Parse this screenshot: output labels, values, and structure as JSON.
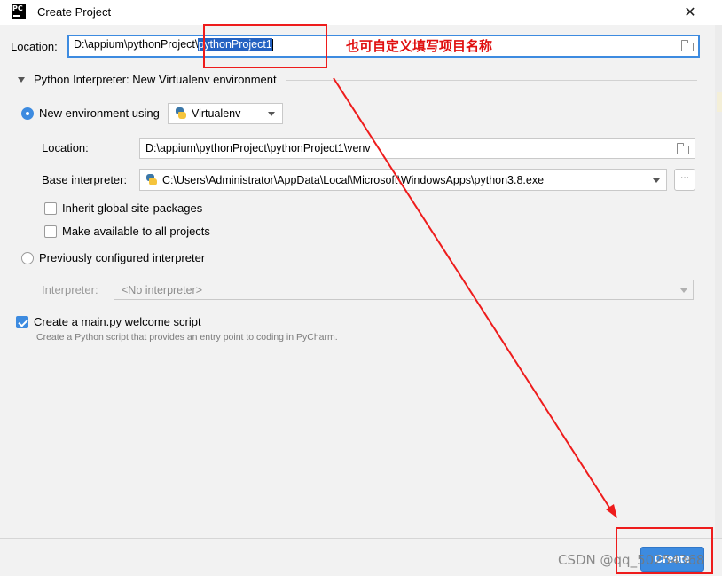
{
  "window": {
    "title": "Create Project",
    "close": "✕"
  },
  "location": {
    "label": "Location:",
    "path_prefix": "D:\\appium\\pythonProject\\",
    "selected_name": "pythonProject1"
  },
  "annotation": "也可自定义填写项目名称",
  "interpreter": {
    "section_title": "Python Interpreter: New Virtualenv environment",
    "new_env": {
      "label": "New environment using",
      "selected": true,
      "tool": "Virtualenv",
      "location_label": "Location:",
      "location_value": "D:\\appium\\pythonProject\\pythonProject1\\venv",
      "base_label": "Base interpreter:",
      "base_value": "C:\\Users\\Administrator\\AppData\\Local\\Microsoft\\WindowsApps\\python3.8.exe",
      "browse": "...",
      "inherit_label": "Inherit global site-packages",
      "inherit_checked": false,
      "available_label": "Make available to all projects",
      "available_checked": false
    },
    "previous": {
      "label": "Previously configured interpreter",
      "selected": false,
      "interpreter_label": "Interpreter:",
      "interpreter_value": "<No interpreter>"
    }
  },
  "welcome": {
    "label": "Create a main.py welcome script",
    "checked": true,
    "hint": "Create a Python script that provides an entry point to coding in PyCharm."
  },
  "footer": {
    "create": "Create"
  },
  "watermark": "CSDN @qq_50254368",
  "colors": {
    "accent": "#3d8be0",
    "annotation_red": "#ee1c1c",
    "selection": "#2462c2"
  }
}
